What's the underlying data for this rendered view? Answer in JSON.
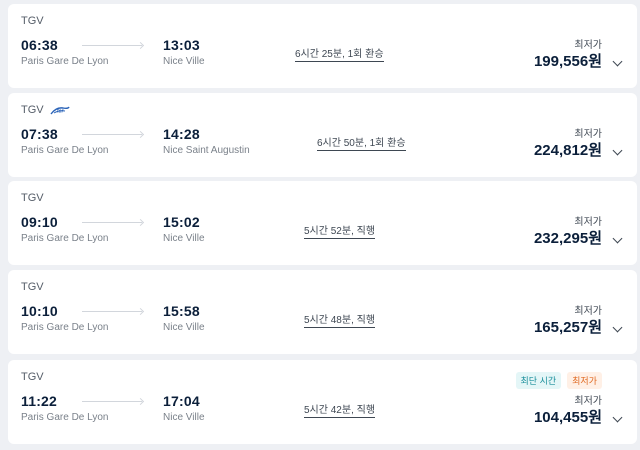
{
  "results": [
    {
      "operator": "TGV",
      "has_partner_logo": false,
      "departure_time": "06:38",
      "departure_station": "Paris Gare De Lyon",
      "arrival_time": "13:03",
      "arrival_station": "Nice Ville",
      "duration": "6시간 25분, 1회 환승",
      "price_label": "최저가",
      "price": "199,556원"
    },
    {
      "operator": "TGV",
      "has_partner_logo": true,
      "partner_logo_icon": "ter-logo-icon",
      "departure_time": "07:38",
      "departure_station": "Paris Gare De Lyon",
      "arrival_time": "14:28",
      "arrival_station": "Nice Saint Augustin",
      "duration": "6시간 50분, 1회 환승",
      "price_label": "최저가",
      "price": "224,812원"
    },
    {
      "operator": "TGV",
      "has_partner_logo": false,
      "departure_time": "09:10",
      "departure_station": "Paris Gare De Lyon",
      "arrival_time": "15:02",
      "arrival_station": "Nice Ville",
      "duration": "5시간 52분, 직행",
      "price_label": "최저가",
      "price": "232,295원"
    },
    {
      "operator": "TGV",
      "has_partner_logo": false,
      "departure_time": "10:10",
      "departure_station": "Paris Gare De Lyon",
      "arrival_time": "15:58",
      "arrival_station": "Nice Ville",
      "duration": "5시간 48분, 직행",
      "price_label": "최저가",
      "price": "165,257원"
    },
    {
      "operator": "TGV",
      "has_partner_logo": false,
      "departure_time": "11:22",
      "departure_station": "Paris Gare De Lyon",
      "arrival_time": "17:04",
      "arrival_station": "Nice Ville",
      "duration": "5시간 42분, 직행",
      "price_label": "최저가",
      "price": "104,455원",
      "badges": {
        "fastest": "최단 시간",
        "cheapest": "최저가"
      }
    }
  ],
  "icons": {
    "connector": "arrow-right-icon",
    "expand": "chevron-down-icon"
  },
  "colors": {
    "background": "#eef0f4",
    "card": "#ffffff",
    "text_primary": "#0b1f3a",
    "text_secondary": "#7a818a",
    "badge_fastest_bg": "#e4f6f7",
    "badge_fastest_text": "#1b8f9b",
    "badge_cheapest_bg": "#fff0e6",
    "badge_cheapest_text": "#e06a22"
  }
}
